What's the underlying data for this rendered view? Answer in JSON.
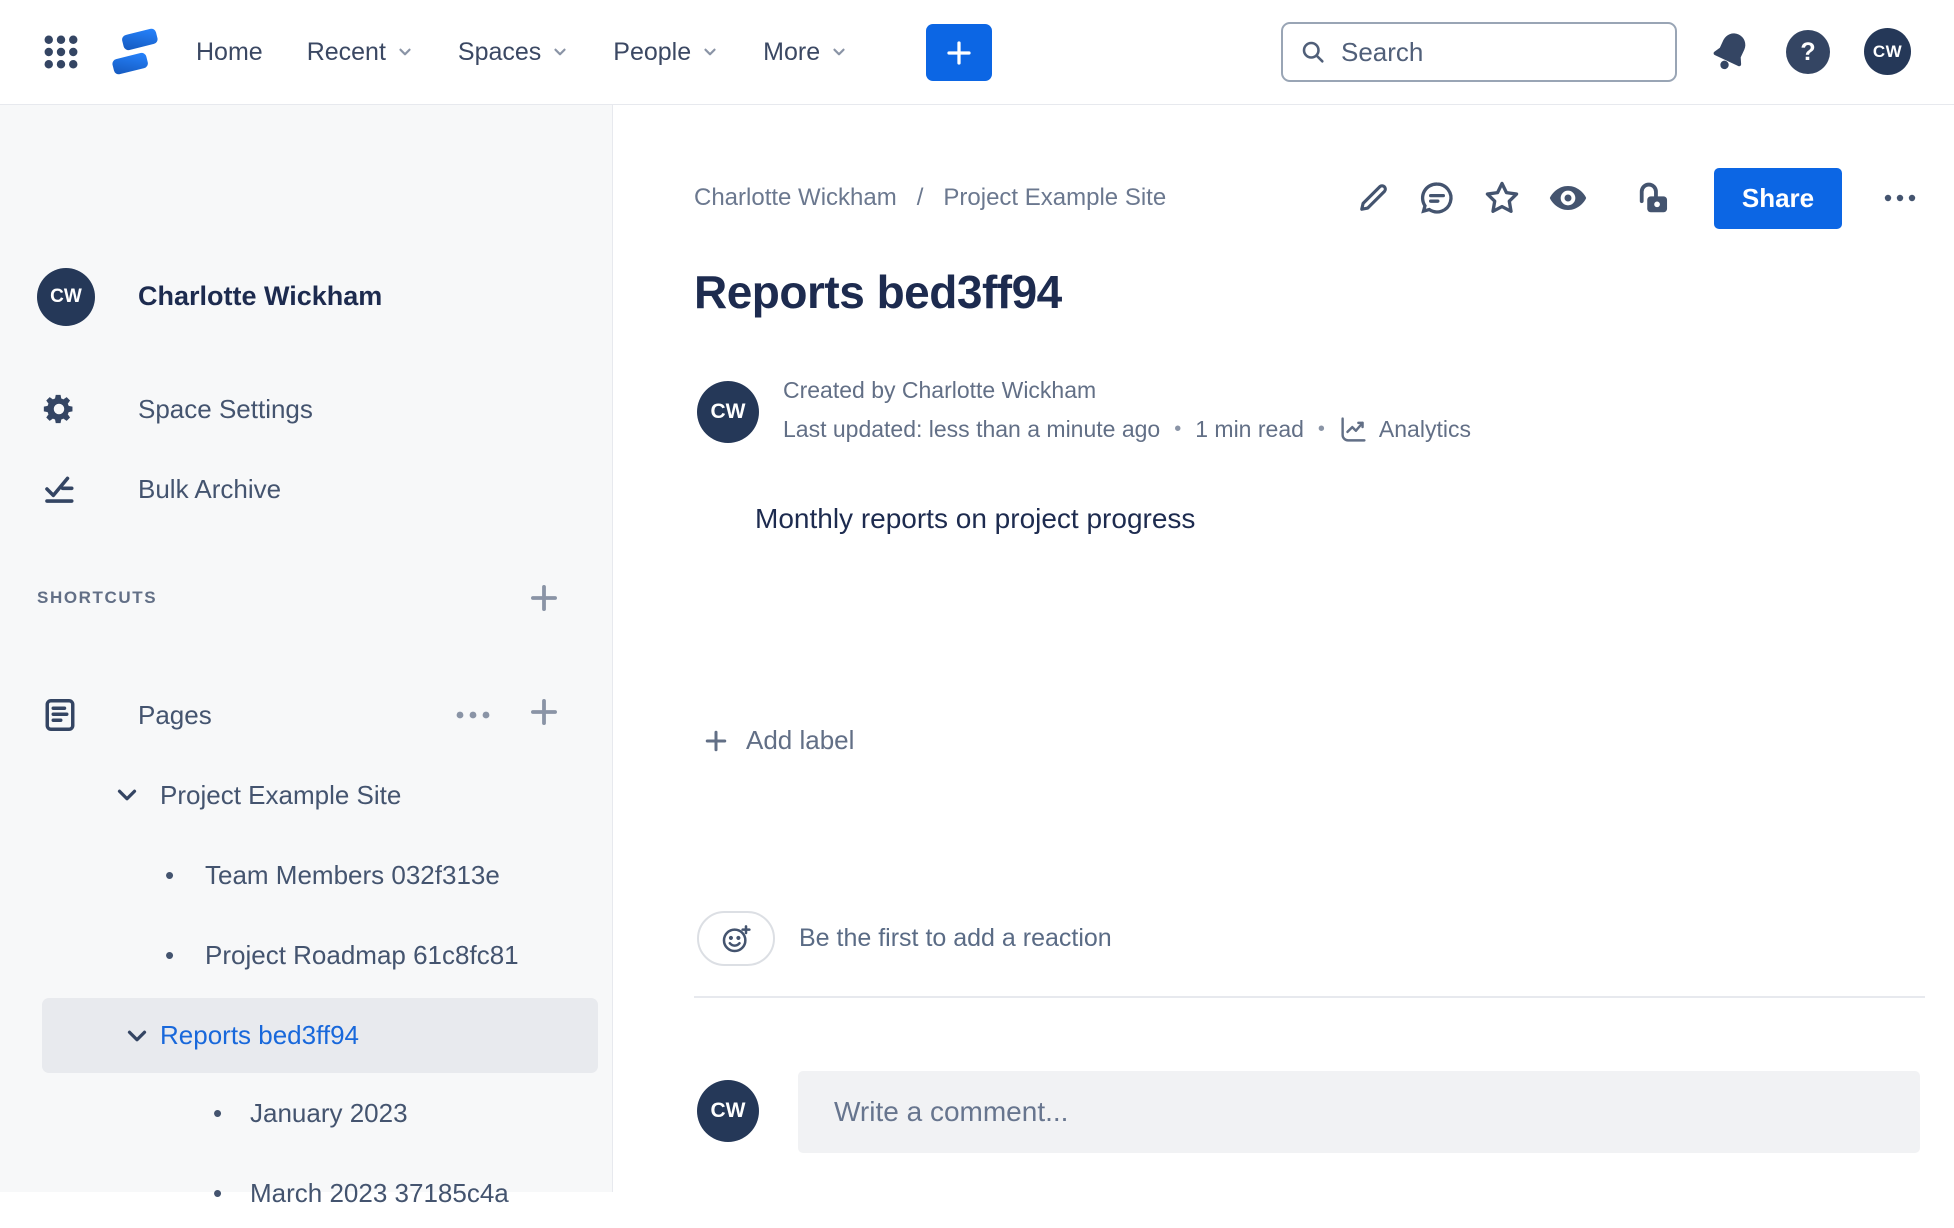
{
  "topnav": {
    "nav": [
      {
        "label": "Home"
      },
      {
        "label": "Recent"
      },
      {
        "label": "Spaces"
      },
      {
        "label": "People"
      },
      {
        "label": "More"
      }
    ],
    "search_placeholder": "Search",
    "help_glyph": "?",
    "avatar_initials": "CW"
  },
  "sidebar": {
    "user_name": "Charlotte Wickham",
    "avatar_initials": "CW",
    "space_settings_label": "Space Settings",
    "bulk_archive_label": "Bulk Archive",
    "shortcuts_heading": "SHORTCUTS",
    "pages_label": "Pages",
    "tree": {
      "root_label": "Project Example Site",
      "items": [
        "Team Members 032f313e",
        "Project Roadmap 61c8fc81"
      ],
      "selected_label": "Reports bed3ff94",
      "selected_children": [
        "January 2023",
        "March 2023 37185c4a"
      ]
    }
  },
  "content": {
    "breadcrumb": {
      "parts": [
        "Charlotte Wickham",
        "Project Example Site"
      ],
      "separator": "/"
    },
    "share_label": "Share",
    "page_title": "Reports bed3ff94",
    "byline": {
      "avatar_initials": "CW",
      "created": "Created by Charlotte Wickham",
      "updated": "Last updated: less than a minute ago",
      "read_time": "1 min read",
      "analytics_label": "Analytics"
    },
    "body_text": "Monthly reports on project progress",
    "add_label_text": "Add label",
    "reaction_prompt": "Be the first to add a reaction",
    "comment_placeholder": "Write a comment...",
    "comment_avatar_initials": "CW"
  },
  "colors": {
    "accent_blue": "#0C66E4",
    "link_blue": "#1868DB",
    "dark_navy_text": "#1D2B4F",
    "icon_navy": "#44546F",
    "muted_gray": "#626F86",
    "sidebar_bg": "#F7F8F9",
    "selected_row_bg": "#E8EAEE"
  }
}
